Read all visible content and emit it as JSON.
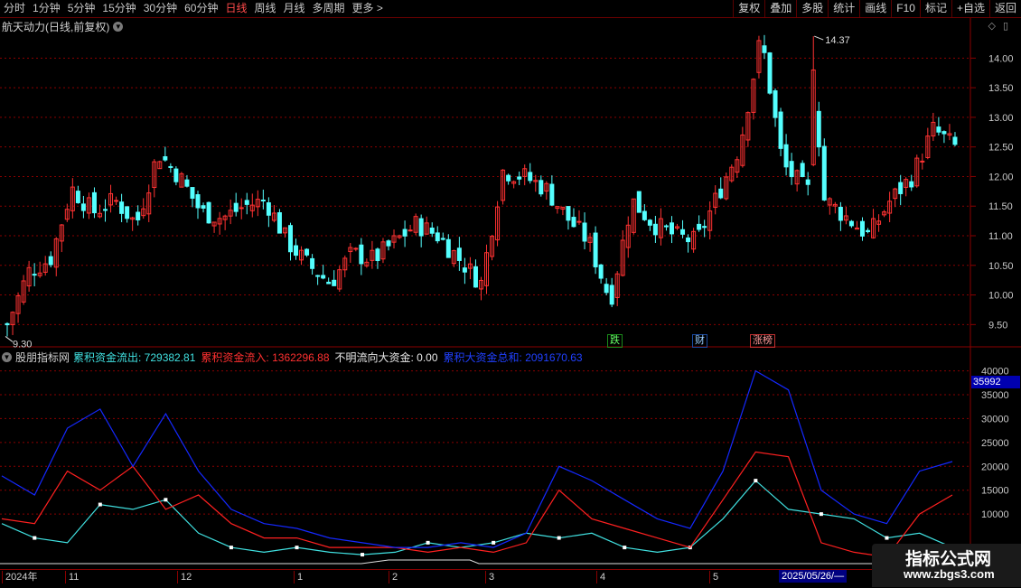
{
  "toolbar": {
    "periods": [
      "分时",
      "1分钟",
      "5分钟",
      "15分钟",
      "30分钟",
      "60分钟",
      "日线",
      "周线",
      "月线",
      "多周期",
      "更多 >"
    ],
    "active_period": "日线",
    "buttons": [
      "复权",
      "叠加",
      "多股",
      "统计",
      "画线",
      "F10",
      "标记",
      "+自选",
      "返回"
    ]
  },
  "stock": {
    "title": "航天动力(日线,前复权)",
    "high_label": "14.37",
    "low_label": "9.30",
    "price_ticks": [
      "14.00",
      "13.50",
      "13.00",
      "12.50",
      "12.00",
      "11.50",
      "11.00",
      "10.50",
      "10.00",
      "9.50"
    ],
    "markers": [
      "跌",
      "财",
      "涨榜"
    ]
  },
  "indicator": {
    "name": "股朋指标网",
    "items": [
      {
        "label": "累积资金流出: 729382.81",
        "color": "#40e0e0"
      },
      {
        "label": "累积资金流入: 1362296.88",
        "color": "#ff3030"
      },
      {
        "label": "不明流向大资金: 0.00",
        "color": "#e8e8e8"
      },
      {
        "label": "累积大资金总和: 2091670.63",
        "color": "#2040ff"
      }
    ],
    "ticks": [
      "40000",
      "35000",
      "30000",
      "25000",
      "20000",
      "15000",
      "10000"
    ],
    "current_value": "35992"
  },
  "xaxis": {
    "labels": [
      "2024年",
      "11",
      "12",
      "1",
      "2",
      "3",
      "4",
      "5"
    ],
    "selected_date": "2025/05/26/—"
  },
  "watermark": {
    "line1": "指标公式网",
    "line2": "www.zbgs3.com"
  },
  "colors": {
    "up": "#ff3232",
    "down": "#54ffff",
    "grid": "#8a0000",
    "blue": "#1428ff"
  },
  "chart_data": [
    {
      "type": "candlestick",
      "title": "航天动力(日线,前复权)",
      "ylim": [
        9.3,
        14.37
      ],
      "max_label": 14.37,
      "min_label": 9.3,
      "close_approx": [
        9.5,
        10.4,
        10.6,
        11.8,
        11.4,
        11.6,
        11.2,
        12.4,
        12.0,
        11.4,
        11.3,
        11.5,
        11.6,
        10.9,
        10.5,
        10.2,
        10.7,
        10.6,
        10.9,
        11.2,
        11.0,
        10.6,
        10.2,
        12.1,
        12.0,
        11.8,
        11.3,
        10.9,
        9.9,
        11.6,
        11.2,
        11.0,
        10.9,
        11.7,
        12.5,
        14.37,
        12.2,
        11.8,
        11.6,
        11.3,
        11.0,
        11.6,
        12.0,
        12.8,
        12.5
      ]
    },
    {
      "type": "line",
      "title": "股朋指标网",
      "ylim": [
        0,
        42000
      ],
      "series": [
        {
          "name": "累积资金流出",
          "values": [
            8000,
            5000,
            4000,
            12000,
            11000,
            13000,
            6000,
            3000,
            2000,
            3000,
            2000,
            1500,
            2000,
            4000,
            3000,
            4000,
            6000,
            5000,
            6000,
            3000,
            2000,
            3000,
            9000,
            17000,
            11000,
            10000,
            9000,
            5000,
            6000,
            3000
          ]
        },
        {
          "name": "累积资金流入",
          "values": [
            9000,
            8000,
            19000,
            15000,
            20000,
            11000,
            14000,
            8000,
            5000,
            5000,
            3000,
            3000,
            3000,
            2000,
            3000,
            2000,
            4000,
            15000,
            9000,
            7000,
            5000,
            3000,
            13000,
            23000,
            22000,
            4000,
            2000,
            1000,
            10000,
            14000
          ]
        },
        {
          "name": "累积大资金总和",
          "values": [
            18000,
            14000,
            28000,
            32000,
            20000,
            31000,
            19000,
            11000,
            8000,
            7000,
            5000,
            4000,
            3000,
            3000,
            4000,
            3000,
            6000,
            20000,
            17000,
            13000,
            9000,
            7000,
            19000,
            40000,
            36000,
            15000,
            10000,
            8000,
            19000,
            21000
          ]
        }
      ]
    }
  ]
}
